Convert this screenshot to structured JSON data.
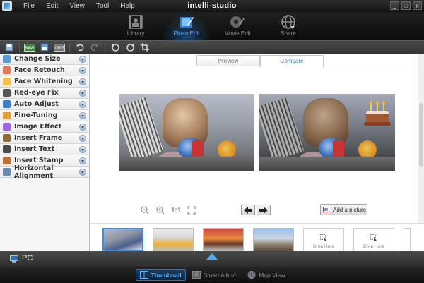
{
  "window": {
    "title": "intelli-studio",
    "minimize": "_",
    "maximize": "□",
    "close": "x"
  },
  "menu": [
    "File",
    "Edit",
    "View",
    "Tool",
    "Help"
  ],
  "modes": [
    {
      "label": "Library",
      "icon": "library-icon",
      "active": false
    },
    {
      "label": "Photo Edit",
      "icon": "photo-edit-icon",
      "active": true
    },
    {
      "label": "Movie Edit",
      "icon": "movie-edit-icon",
      "active": false
    },
    {
      "label": "Share",
      "icon": "share-icon",
      "active": false
    }
  ],
  "toolbar": {
    "raw_label": "RAW",
    "size_label": "ORG"
  },
  "tools": [
    {
      "label": "Change Size",
      "icon": "change-size-icon",
      "color": "#5b9bd5"
    },
    {
      "label": "Face Retouch",
      "icon": "face-retouch-icon",
      "color": "#e07a5f"
    },
    {
      "label": "Face Whitening",
      "icon": "face-whitening-icon",
      "color": "#f2c14e"
    },
    {
      "label": "Red-eye Fix",
      "icon": "red-eye-icon",
      "color": "#555555"
    },
    {
      "label": "Auto Adjust",
      "icon": "auto-adjust-icon",
      "color": "#3d7cc9"
    },
    {
      "label": "Fine-Tuning",
      "icon": "fine-tuning-icon",
      "color": "#e09f3e"
    },
    {
      "label": "Image Effect",
      "icon": "image-effect-icon",
      "color": "#9c6ade"
    },
    {
      "label": "Insert Frame",
      "icon": "insert-frame-icon",
      "color": "#8b6b3e"
    },
    {
      "label": "Insert Text",
      "icon": "insert-text-icon",
      "color": "#4a4a4a"
    },
    {
      "label": "Insert Stamp",
      "icon": "insert-stamp-icon",
      "color": "#c0703a"
    },
    {
      "label": "Horizontal Alignment",
      "icon": "horizontal-alignment-icon",
      "color": "#6a8caf"
    }
  ],
  "tabs": {
    "preview": "Preview",
    "compare": "Compare"
  },
  "zoom": {
    "one_to_one": "1:1"
  },
  "add_picture": "Add a picture",
  "filmstrip": {
    "drop_label": "Drop Here"
  },
  "bottom": {
    "pc_label": "PC"
  },
  "views": [
    {
      "label": "Thumbnail",
      "active": true
    },
    {
      "label": "Smart Album",
      "active": false
    },
    {
      "label": "Map View",
      "active": false
    }
  ],
  "colors": {
    "accent": "#4aa8ff",
    "selected_border": "#3a8ee6"
  }
}
